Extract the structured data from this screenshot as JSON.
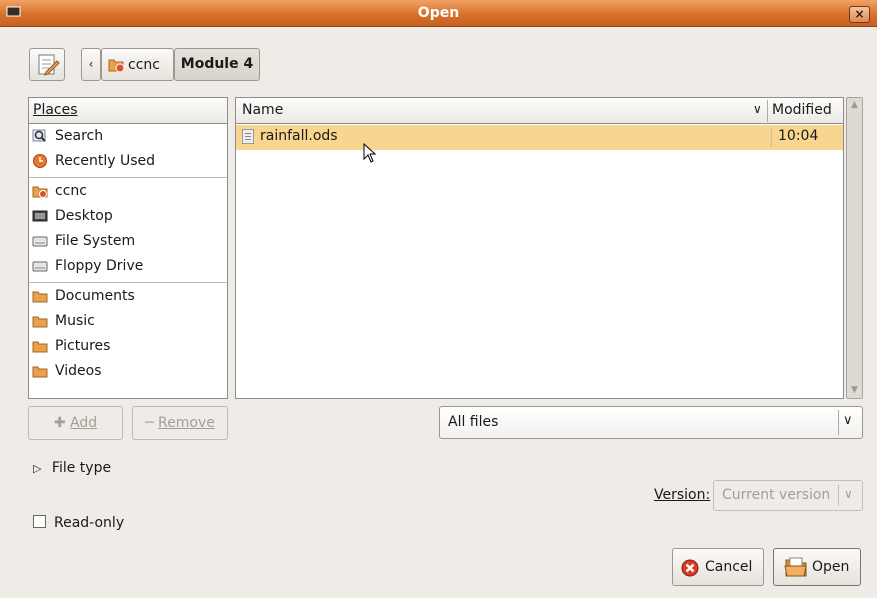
{
  "window": {
    "title": "Open",
    "close_glyph": "×"
  },
  "toolbar": {
    "back_glyph": "‹",
    "breadcrumbs": [
      {
        "label": "ccnc",
        "icon": "home-folder-icon"
      },
      {
        "label": "Module 4",
        "icon": ""
      }
    ]
  },
  "places": {
    "header": "Places",
    "items": [
      {
        "label": "Search",
        "icon": "search-icon"
      },
      {
        "label": "Recently Used",
        "icon": "recently-used-icon"
      },
      {
        "label": "ccnc",
        "icon": "home-folder-icon"
      },
      {
        "label": "Desktop",
        "icon": "desktop-icon"
      },
      {
        "label": "File System",
        "icon": "drive-icon"
      },
      {
        "label": "Floppy Drive",
        "icon": "drive-icon"
      },
      {
        "label": "Documents",
        "icon": "folder-icon"
      },
      {
        "label": "Music",
        "icon": "folder-icon"
      },
      {
        "label": "Pictures",
        "icon": "folder-icon"
      },
      {
        "label": "Videos",
        "icon": "folder-icon"
      }
    ]
  },
  "files": {
    "columns": {
      "name": "Name",
      "modified": "Modified"
    },
    "rows": [
      {
        "name": "rainfall.ods",
        "modified": "10:04",
        "selected": true
      }
    ]
  },
  "buttons": {
    "add": "Add",
    "remove": "Remove",
    "cancel": "Cancel",
    "open": "Open"
  },
  "filter": {
    "value": "All files"
  },
  "filetype": {
    "label": "File type"
  },
  "version": {
    "label": "Version:",
    "value": "Current version"
  },
  "readonly": {
    "label": "Read-only",
    "checked": false
  },
  "colors": {
    "titlebar": "#d8712a",
    "selection": "#f8d690",
    "folder": "#e8a24a"
  }
}
